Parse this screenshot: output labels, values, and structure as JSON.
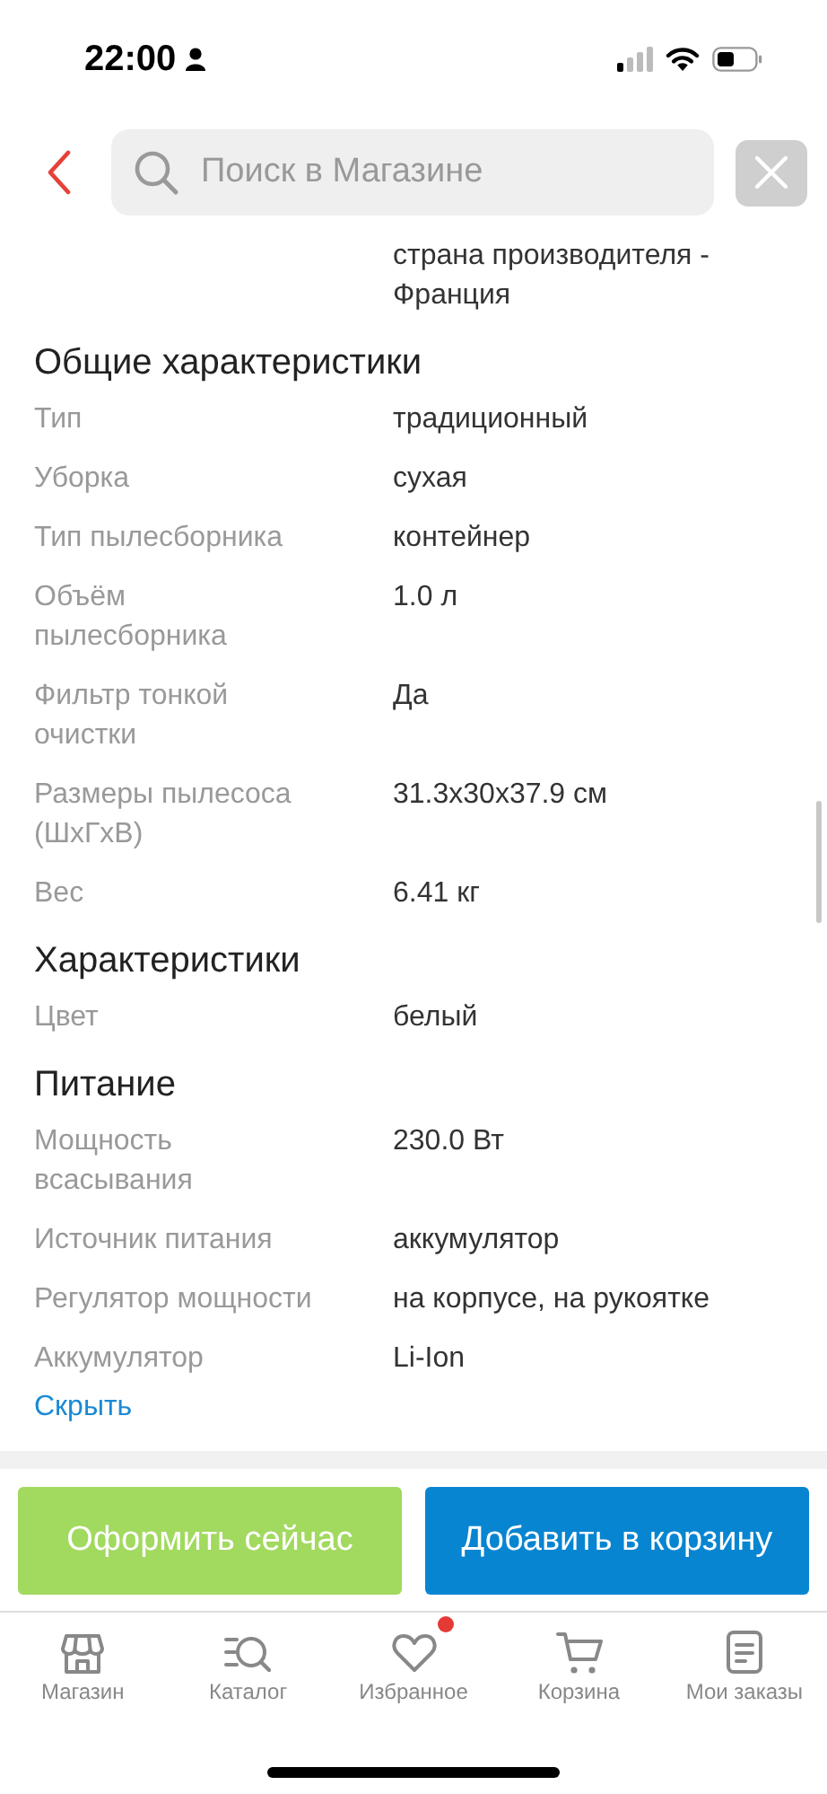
{
  "status_bar": {
    "time": "22:00"
  },
  "search": {
    "placeholder": "Поиск в Магазине"
  },
  "previous_value": "страна производителя - Франция",
  "sections": [
    {
      "title": "Общие характеристики",
      "rows": [
        {
          "label": "Тип",
          "value": "традиционный"
        },
        {
          "label": "Уборка",
          "value": "сухая"
        },
        {
          "label": "Тип пылесборника",
          "value": "контейнер"
        },
        {
          "label": "Объём пылесборника",
          "value": "1.0 л"
        },
        {
          "label": "Фильтр тонкой очистки",
          "value": "Да"
        },
        {
          "label": "Размеры пылесоса (ШхГхВ)",
          "value": "31.3x30x37.9 см"
        },
        {
          "label": "Вес",
          "value": "6.41 кг"
        }
      ]
    },
    {
      "title": "Характеристики",
      "rows": [
        {
          "label": "Цвет",
          "value": "белый"
        }
      ]
    },
    {
      "title": "Питание",
      "rows": [
        {
          "label": "Мощность всасывания",
          "value": "230.0 Вт"
        },
        {
          "label": "Источник питания",
          "value": "аккумулятор"
        },
        {
          "label": "Регулятор мощности",
          "value": "на корпусе, на рукоятке"
        },
        {
          "label": "Аккумулятор",
          "value": "Li-Ion"
        }
      ]
    }
  ],
  "toggle_link": "Скрыть",
  "buttons": [
    {
      "label": "Оформить сейчас",
      "kind": "checkout"
    },
    {
      "label": "Добавить в корзину",
      "kind": "cart"
    }
  ],
  "nav": [
    {
      "label": "Магазин",
      "kind": "store",
      "badge": false
    },
    {
      "label": "Каталог",
      "kind": "catalog",
      "badge": false
    },
    {
      "label": "Избранное",
      "kind": "favorites",
      "badge": true
    },
    {
      "label": "Корзина",
      "kind": "cart",
      "badge": false
    },
    {
      "label": "Мои заказы",
      "kind": "orders",
      "badge": false
    }
  ]
}
